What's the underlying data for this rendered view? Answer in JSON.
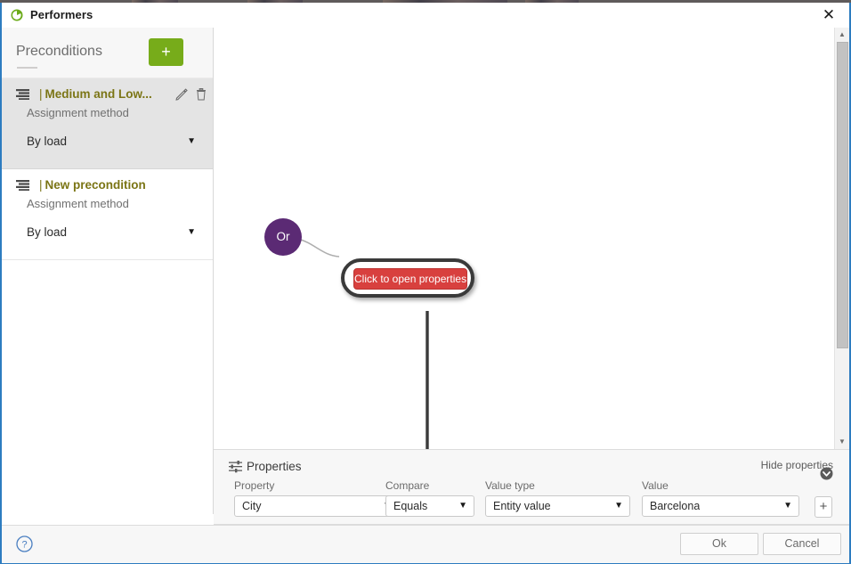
{
  "window": {
    "title": "Performers",
    "app_icon": "performers-circle-icon",
    "close_label": "✕",
    "accent_border": "#2d7cc0"
  },
  "sidebar": {
    "header": {
      "title": "Preconditions",
      "add_label": "+",
      "add_color": "#77ac1a"
    },
    "preconditions": [
      {
        "name": "Medium and Low...",
        "sub_label": "Assignment method",
        "method_value": "By load",
        "selected": true,
        "has_edit": true,
        "has_delete": true
      },
      {
        "name": "New precondition",
        "sub_label": "Assignment method",
        "method_value": "By load",
        "selected": false,
        "has_edit": false,
        "has_delete": false
      }
    ]
  },
  "canvas": {
    "or_node": {
      "label": "Or",
      "color": "#5b2a74"
    },
    "condition_node": {
      "label": "Click to open properties",
      "fill": "#d8403e",
      "outline": "#3a3a3a"
    },
    "scrollbar": {
      "up_arrow": "▲",
      "down_arrow": "▼"
    }
  },
  "properties": {
    "title": "Properties",
    "icon": "sliders-icon",
    "hide_label": "Hide properties",
    "hide_icon": "chevron-down-circle-icon",
    "fields": [
      {
        "label": "Property",
        "value": "City",
        "arrow": "▼"
      },
      {
        "label": "Compare",
        "value": "Equals",
        "arrow": "▼"
      },
      {
        "label": "Value type",
        "value": "Entity value",
        "arrow": "▼"
      },
      {
        "label": "Value",
        "value": "Barcelona",
        "arrow": "▼"
      }
    ],
    "add_value_label": "+"
  },
  "footer": {
    "help_icon": "help-question-icon",
    "ok_label": "Ok",
    "cancel_label": "Cancel"
  }
}
